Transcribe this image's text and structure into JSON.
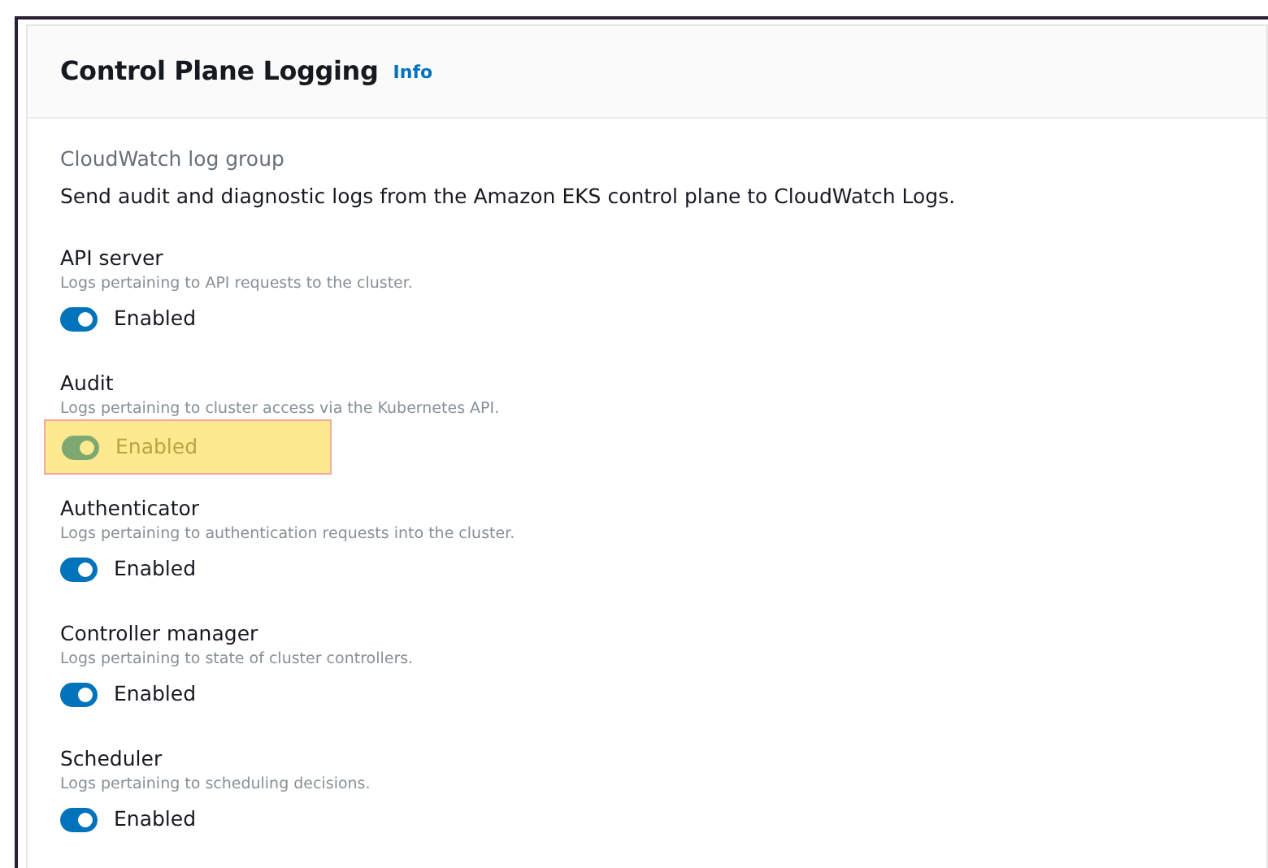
{
  "panel": {
    "title": "Control Plane Logging",
    "info_link": "Info"
  },
  "section": {
    "label": "CloudWatch log group",
    "description": "Send audit and diagnostic logs from the Amazon EKS control plane to CloudWatch Logs."
  },
  "log_types": [
    {
      "name": "API server",
      "description": "Logs pertaining to API requests to the cluster.",
      "on": true,
      "state_label": "Enabled",
      "highlighted": false
    },
    {
      "name": "Audit",
      "description": "Logs pertaining to cluster access via the Kubernetes API.",
      "on": true,
      "state_label": "Enabled",
      "highlighted": true
    },
    {
      "name": "Authenticator",
      "description": "Logs pertaining to authentication requests into the cluster.",
      "on": true,
      "state_label": "Enabled",
      "highlighted": false
    },
    {
      "name": "Controller manager",
      "description": "Logs pertaining to state of cluster controllers.",
      "on": true,
      "state_label": "Enabled",
      "highlighted": false
    },
    {
      "name": "Scheduler",
      "description": "Logs pertaining to scheduling decisions.",
      "on": true,
      "state_label": "Enabled",
      "highlighted": false
    }
  ]
}
